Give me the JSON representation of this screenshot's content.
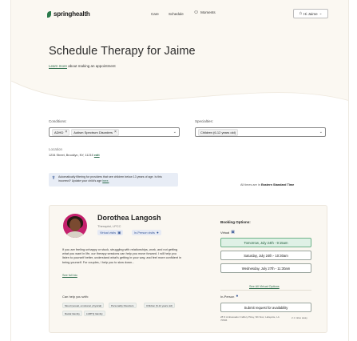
{
  "nav": {
    "brand": "springhealth",
    "care": "Care",
    "schedule": "Schedule",
    "moments": "Moments",
    "user": "Hi Jaime"
  },
  "hero": {
    "title": "Schedule Therapy for Jaime",
    "learn_more": "Learn more",
    "learn_more_suffix": "about making an appointment"
  },
  "filters": {
    "conditions_label": "Conditions:",
    "conditions": [
      "ADHD",
      "Autism Spectrum Disorders"
    ],
    "specialties_label": "Specialties:",
    "specialties": [
      "Children (6-12 years old)"
    ],
    "location_label": "Location",
    "location_value": "1234 Street, Brooklyn, NY, 11215",
    "location_edit": "edit"
  },
  "notice": {
    "text": "Automatically filtering for providers that see children below 13 years of age. Is this incorrect? Update your child's age",
    "link": "here."
  },
  "timezone": {
    "prefix": "All times are in",
    "zone": "Eastern Standard Time"
  },
  "provider": {
    "name": "Dorothea Langosh",
    "title": "Therapist, LPCC",
    "virtual_chip": "Virtual visits",
    "inperson_chip": "In-Person visits",
    "bio": "If you are feeling unhappy or stuck, struggling with relationships, work, and not getting what you want in life, our therapy sessions can help you move forward. I will help you listen to yourself better, understand what's getting in your way, and feel more confident in being yourself. For couples, I help you to slow down...",
    "bio_more": "See full bio",
    "helps_label": "Can help you with:",
    "tags": [
      "Mood (sexual, emotional, physical)",
      "Personality Disorders",
      "Children (6-12 years old)",
      "Racial Identity",
      "LGBTQ Identity"
    ]
  },
  "booking": {
    "label": "Booking Options:",
    "virtual_label": "Virtual",
    "slots": [
      "Tomorrow, July 24th - 9:15am",
      "Saturday, July 24th - 10:30am",
      "Wednesday, July 27th - 11:30am"
    ],
    "see_all": "See All Virtual Options",
    "inperson_label": "In-Person",
    "submit": "Submit request for availability",
    "address": "28 N Ambassador Caffery Pkwy, 6th floor, Lafayette, LA 70506",
    "distance": "2.1 miles away"
  },
  "colors": {
    "page_bg": "#fbf8f2",
    "brand_green": "#2b6b4b",
    "selected_slot": "#dff1e6",
    "info_blue": "#3a5a9a"
  }
}
